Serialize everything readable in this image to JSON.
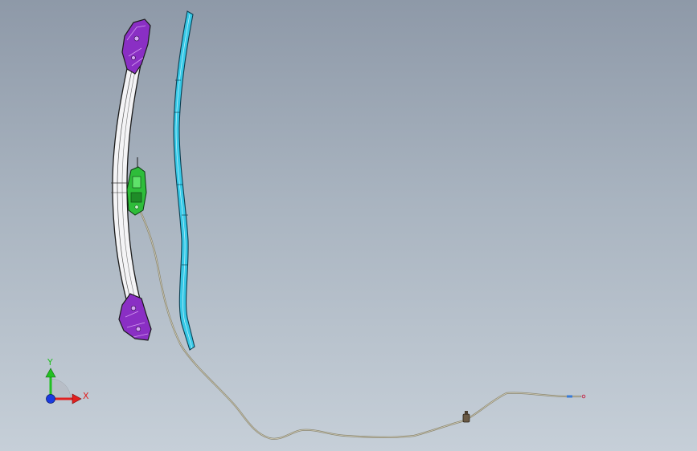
{
  "viewport": {
    "background_top": "#8e99a8",
    "background_bottom": "#c6cfd8"
  },
  "model": {
    "bumper_beam": {
      "body_color": "#f4f4f6",
      "end_bracket_color": "#8a2fc4",
      "outline_color": "#1a1a1a"
    },
    "reinforcement_strip": {
      "color": "#37c8e6"
    },
    "sensor_bracket": {
      "color": "#2ebd3a"
    },
    "cable_harness": {
      "color": "#8a8670"
    },
    "cable_connector": {
      "color": "#6a5a45"
    },
    "cable_tip": {
      "color": "#3a7bd5"
    }
  },
  "triad": {
    "y_label": "Y",
    "x_label": "X",
    "y_color": "#22c022",
    "x_color": "#e02020",
    "z_color": "#1a3ae0"
  }
}
